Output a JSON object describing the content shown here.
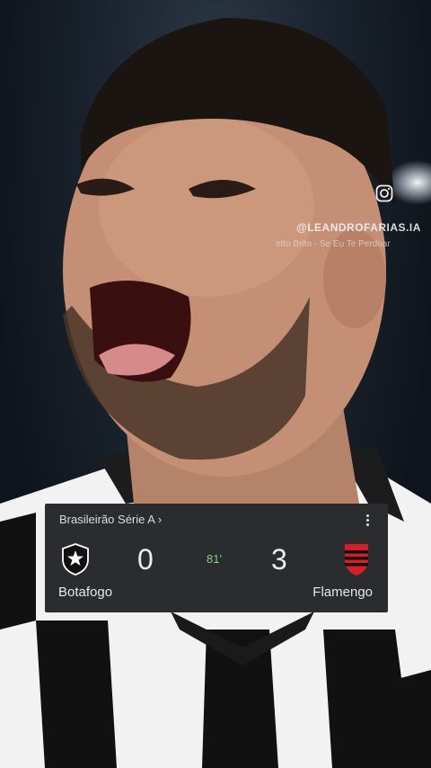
{
  "watermark": {
    "icon": "instagram-icon",
    "handle": "@LEANDROFARIAS.IA",
    "song": "etto Brito - Se Eu Te Perdoar"
  },
  "scorecard": {
    "league": "Brasileirão Série A ›",
    "home": {
      "name": "Botafogo",
      "score": "0",
      "logo": "botafogo-crest-icon"
    },
    "away": {
      "name": "Flamengo",
      "score": "3",
      "logo": "flamengo-crest-icon"
    },
    "minute": "81'",
    "menu_icon": "more-vertical-icon"
  },
  "colors": {
    "card_bg": "#2b2c2f",
    "minute_green": "#7fd27f",
    "flamengo_red": "#d41f26"
  }
}
